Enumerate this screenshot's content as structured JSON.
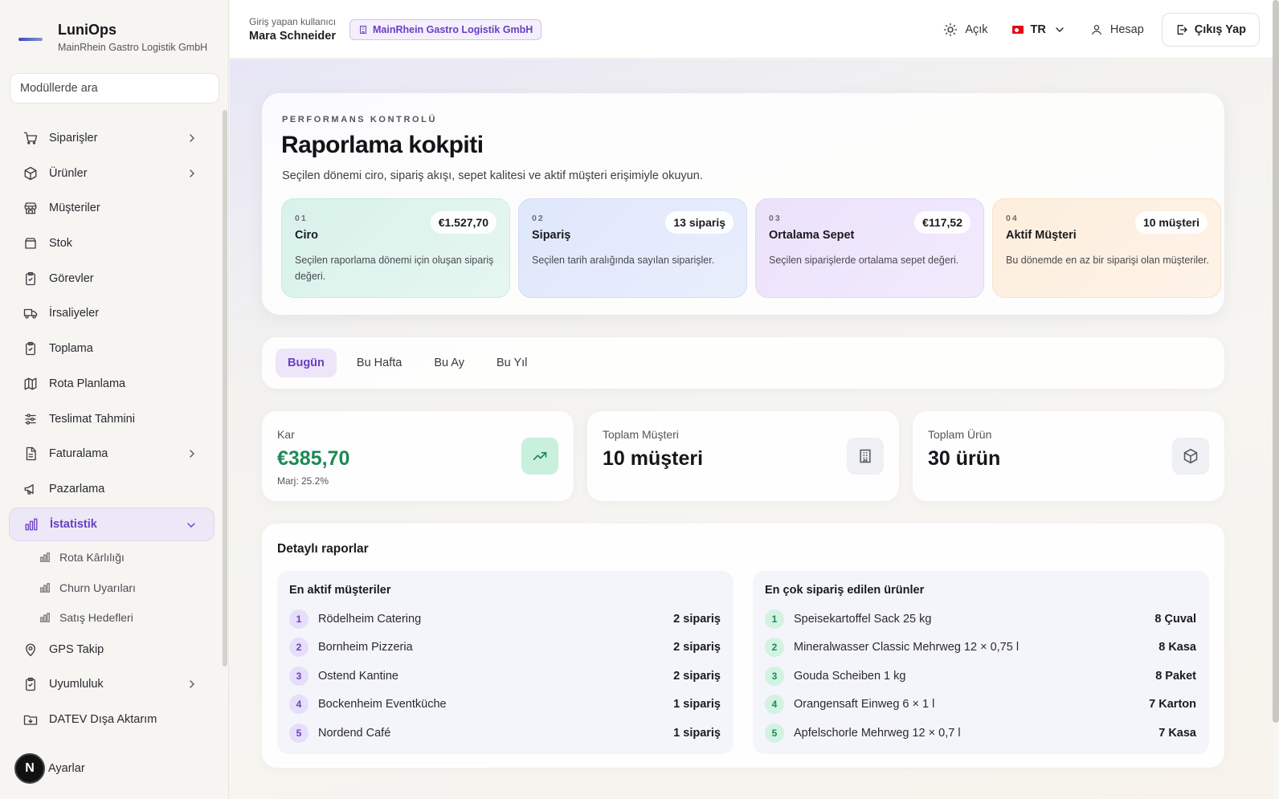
{
  "brand": {
    "title": "LuniOps",
    "subtitle": "MainRhein Gastro Logistik GmbH"
  },
  "search": {
    "placeholder": "Modüllerde ara"
  },
  "sidebar": {
    "items": [
      {
        "label": "Siparişler",
        "icon": "cart-icon",
        "expandable": true
      },
      {
        "label": "Ürünler",
        "icon": "box-icon",
        "expandable": true
      },
      {
        "label": "Müşteriler",
        "icon": "store-icon",
        "expandable": false
      },
      {
        "label": "Stok",
        "icon": "archive-icon",
        "expandable": false
      },
      {
        "label": "Görevler",
        "icon": "clipboard-icon",
        "expandable": false
      },
      {
        "label": "İrsaliyeler",
        "icon": "truck-icon",
        "expandable": false
      },
      {
        "label": "Toplama",
        "icon": "clipboard-icon",
        "expandable": false
      },
      {
        "label": "Rota Planlama",
        "icon": "map-icon",
        "expandable": false
      },
      {
        "label": "Teslimat Tahmini",
        "icon": "sliders-icon",
        "expandable": false
      },
      {
        "label": "Faturalama",
        "icon": "file-icon",
        "expandable": true
      },
      {
        "label": "Pazarlama",
        "icon": "megaphone-icon",
        "expandable": false
      },
      {
        "label": "İstatistik",
        "icon": "bar-chart-icon",
        "expandable": true,
        "active": true
      }
    ],
    "subitems": [
      {
        "label": "Rota Kârlılığı"
      },
      {
        "label": "Churn Uyarıları"
      },
      {
        "label": "Satış Hedefleri"
      }
    ],
    "items_after": [
      {
        "label": "GPS Takip",
        "icon": "map-pin-icon",
        "expandable": false
      },
      {
        "label": "Uyumluluk",
        "icon": "clipboard-icon",
        "expandable": true
      },
      {
        "label": "DATEV Dışa Aktarım",
        "icon": "download-folder-icon",
        "expandable": false
      }
    ],
    "settings_label": "Ayarlar",
    "settings_badge": "N"
  },
  "header": {
    "user_label": "Giriş yapan kullanıcı",
    "user_name": "Mara Schneider",
    "company_chip": "MainRhein Gastro Logistik GmbH",
    "theme_label": "Açık",
    "lang_label": "TR",
    "account_label": "Hesap",
    "logout_label": "Çıkış Yap"
  },
  "hero": {
    "eyebrow": "PERFORMANS KONTROLÜ",
    "title": "Raporlama kokpiti",
    "subtitle": "Seçilen dönemi ciro, sipariş akışı, sepet kalitesi ve aktif müşteri erişimiyle okuyun.",
    "kpis": [
      {
        "num": "01",
        "name": "Ciro",
        "value": "€1.527,70",
        "desc": "Seçilen raporlama dönemi için oluşan sipariş değeri."
      },
      {
        "num": "02",
        "name": "Sipariş",
        "value": "13 sipariş",
        "desc": "Seçilen tarih aralığında sayılan siparişler."
      },
      {
        "num": "03",
        "name": "Ortalama Sepet",
        "value": "€117,52",
        "desc": "Seçilen siparişlerde ortalama sepet değeri."
      },
      {
        "num": "04",
        "name": "Aktif Müşteri",
        "value": "10 müşteri",
        "desc": "Bu dönemde en az bir siparişi olan müşteriler."
      }
    ]
  },
  "period_tabs": [
    {
      "label": "Bugün",
      "active": true
    },
    {
      "label": "Bu Hafta",
      "active": false
    },
    {
      "label": "Bu Ay",
      "active": false
    },
    {
      "label": "Bu Yıl",
      "active": false
    }
  ],
  "stats": [
    {
      "label": "Kar",
      "value": "€385,70",
      "sub": "Marj: 25.2%",
      "icon": "trending-up-icon"
    },
    {
      "label": "Toplam Müşteri",
      "value": "10 müşteri",
      "sub": "",
      "icon": "building-icon"
    },
    {
      "label": "Toplam Ürün",
      "value": "30 ürün",
      "sub": "",
      "icon": "cube-icon"
    }
  ],
  "reports": {
    "title": "Detaylı raporlar",
    "customers": {
      "title": "En aktif müşteriler",
      "rows": [
        {
          "rank": "1",
          "name": "Rödelheim Catering",
          "value": "2 sipariş"
        },
        {
          "rank": "2",
          "name": "Bornheim Pizzeria",
          "value": "2 sipariş"
        },
        {
          "rank": "3",
          "name": "Ostend Kantine",
          "value": "2 sipariş"
        },
        {
          "rank": "4",
          "name": "Bockenheim Eventküche",
          "value": "1 sipariş"
        },
        {
          "rank": "5",
          "name": "Nordend Café",
          "value": "1 sipariş"
        }
      ]
    },
    "products": {
      "title": "En çok sipariş edilen ürünler",
      "rows": [
        {
          "rank": "1",
          "name": "Speisekartoffel Sack 25 kg",
          "value": "8 Çuval"
        },
        {
          "rank": "2",
          "name": "Mineralwasser Classic Mehrweg 12 × 0,75 l",
          "value": "8 Kasa"
        },
        {
          "rank": "3",
          "name": "Gouda Scheiben 1 kg",
          "value": "8 Paket"
        },
        {
          "rank": "4",
          "name": "Orangensaft Einweg 6 × 1 l",
          "value": "7 Karton"
        },
        {
          "rank": "5",
          "name": "Apfelschorle Mehrweg 12 × 0,7 l",
          "value": "7 Kasa"
        }
      ]
    }
  },
  "colors": {
    "accent": "#6b3fc4",
    "profit_green": "#1c8a55"
  }
}
